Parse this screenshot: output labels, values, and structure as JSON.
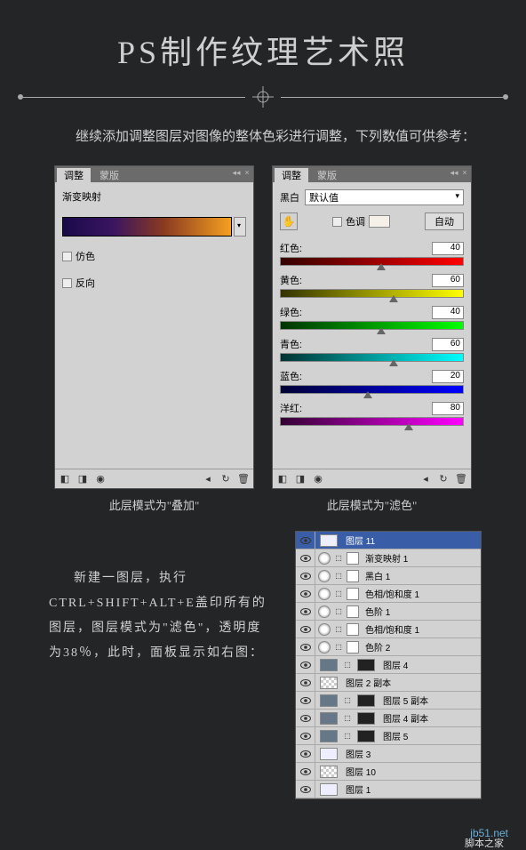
{
  "title": "PS制作纹理艺术照",
  "intro": "继续添加调整图层对图像的整体色彩进行调整，下列数值可供参考：",
  "panel_tabs": {
    "adjust": "调整",
    "mask": "蒙版"
  },
  "gradient_panel": {
    "label": "渐变映射",
    "dither": "仿色",
    "reverse": "反向",
    "caption": "此层模式为\"叠加\""
  },
  "bw_panel": {
    "label": "黑白",
    "preset": "默认值",
    "tint": "色调",
    "auto": "自动",
    "sliders": [
      {
        "name": "红色:",
        "value": "40",
        "cls": "gr-red",
        "pos": 55
      },
      {
        "name": "黄色:",
        "value": "60",
        "cls": "gr-yellow",
        "pos": 62
      },
      {
        "name": "绿色:",
        "value": "40",
        "cls": "gr-green",
        "pos": 55
      },
      {
        "name": "青色:",
        "value": "60",
        "cls": "gr-cyan",
        "pos": 62
      },
      {
        "name": "蓝色:",
        "value": "20",
        "cls": "gr-blue",
        "pos": 48
      },
      {
        "name": "洋红:",
        "value": "80",
        "cls": "gr-magenta",
        "pos": 70
      }
    ],
    "caption": "此层模式为\"滤色\""
  },
  "desc": "新建一图层，执行CTRL+SHIFT+ALT+E盖印所有的图层，图层模式为\"滤色\"，透明度为38％，此时，面板显示如右图：",
  "layers": [
    {
      "name": "图层 11",
      "selected": true,
      "type": "img"
    },
    {
      "name": "渐变映射 1",
      "type": "adj"
    },
    {
      "name": "黑白 1",
      "type": "adj"
    },
    {
      "name": "色相/饱和度 1",
      "type": "adj"
    },
    {
      "name": "色阶 1",
      "type": "adj"
    },
    {
      "name": "色相/饱和度 1",
      "type": "adj"
    },
    {
      "name": "色阶 2",
      "type": "adj"
    },
    {
      "name": "图层 4",
      "type": "imgmask"
    },
    {
      "name": "图层 2 副本",
      "type": "checker"
    },
    {
      "name": "图层 5 副本",
      "type": "imgmask"
    },
    {
      "name": "图层 4 副本",
      "type": "imgmask"
    },
    {
      "name": "图层 5",
      "type": "imgmask"
    },
    {
      "name": "图层 3",
      "type": "img"
    },
    {
      "name": "图层 10",
      "type": "checker"
    },
    {
      "name": "图层 1",
      "type": "img"
    }
  ],
  "watermark": {
    "url": "jb51.net",
    "name": "脚本之家"
  }
}
